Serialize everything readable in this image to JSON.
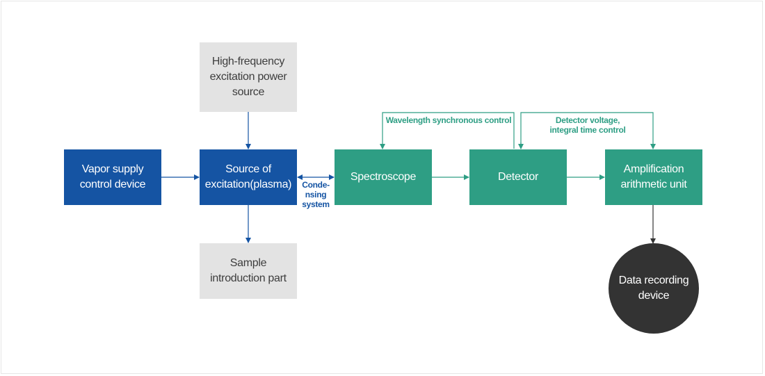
{
  "diagram": {
    "nodes": {
      "hf_power": {
        "label": "High-frequency\nexcitation power\nsource",
        "kind": "peripheral"
      },
      "vapor_supply": {
        "label": "Vapor supply\ncontrol device",
        "kind": "primary"
      },
      "excitation_source": {
        "label": "Source of\nexcitation(plasma)",
        "kind": "primary"
      },
      "sample_intro": {
        "label": "Sample\nintroduction part",
        "kind": "peripheral"
      },
      "spectroscope": {
        "label": "Spectroscope",
        "kind": "processing"
      },
      "detector": {
        "label": "Detector",
        "kind": "processing"
      },
      "amplification": {
        "label": "Amplification\narithmetic unit",
        "kind": "processing"
      },
      "data_recording": {
        "label": "Data recording\ndevice",
        "kind": "output"
      }
    },
    "edge_labels": {
      "condensing": "Conde-\nnsing\nsystem",
      "wavelength_control": "Wavelength synchronous control",
      "detector_voltage": "Detector voltage,\nintegral time control"
    },
    "edges": [
      {
        "from": "hf_power",
        "to": "excitation_source"
      },
      {
        "from": "vapor_supply",
        "to": "excitation_source"
      },
      {
        "from": "excitation_source",
        "to": "sample_intro"
      },
      {
        "from": "excitation_source",
        "to": "spectroscope",
        "bidirectional": true,
        "label": "condensing"
      },
      {
        "from": "spectroscope",
        "to": "detector"
      },
      {
        "from": "detector",
        "to": "amplification"
      },
      {
        "from": "detector",
        "to": "spectroscope",
        "label": "wavelength_control"
      },
      {
        "from": "amplification",
        "to": "detector",
        "label": "detector_voltage"
      },
      {
        "from": "amplification",
        "to": "data_recording"
      }
    ],
    "colors": {
      "primary": "#1554a3",
      "processing": "#2e9e84",
      "peripheral": "#e3e3e3",
      "output": "#333333"
    }
  }
}
